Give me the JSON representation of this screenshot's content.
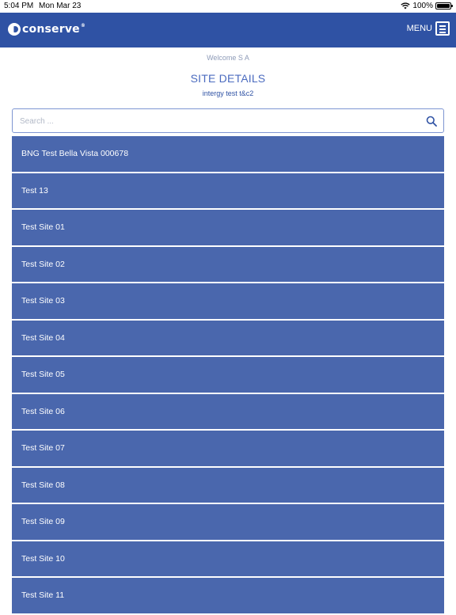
{
  "status_bar": {
    "time": "5:04 PM",
    "date": "Mon Mar 23",
    "battery": "100%"
  },
  "header": {
    "logo_text": "conserve",
    "logo_reg": "®",
    "menu_label": "MENU"
  },
  "welcome": "Welcome S A",
  "title": "SITE DETAILS",
  "subtitle": "intergy test t&c2",
  "search": {
    "placeholder": "Search ...",
    "value": ""
  },
  "sites": [
    "BNG Test Bella Vista 000678",
    "Test 13",
    "Test Site 01",
    "Test Site 02",
    "Test Site 03",
    "Test Site 04",
    "Test Site 05",
    "Test Site 06",
    "Test Site 07",
    "Test Site 08",
    "Test Site 09",
    "Test Site 10",
    "Test Site 11"
  ],
  "colors": {
    "header": "#2f52a4",
    "list_item": "#4a67ad",
    "title": "#4b6bbf"
  }
}
